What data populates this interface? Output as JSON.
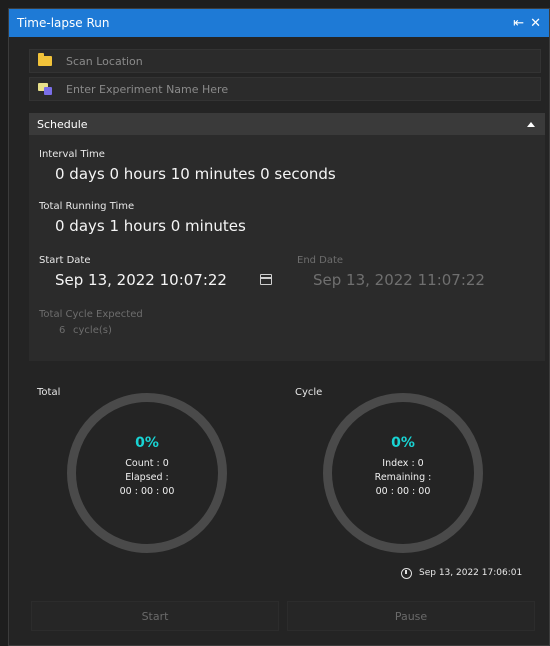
{
  "window": {
    "title": "Time-lapse Run",
    "pin_glyph": "⇤",
    "close_glyph": "✕"
  },
  "scan_location": {
    "placeholder": "Scan Location",
    "icon": "folder-icon"
  },
  "experiment_name": {
    "placeholder": "Enter Experiment Name Here",
    "icon": "tag-icon"
  },
  "schedule": {
    "header": "Schedule",
    "interval_label": "Interval Time",
    "interval_value": "0 days  0 hours  10 minutes  0 seconds",
    "total_running_label": "Total Running Time",
    "total_running_value": "0 days  1 hours  0 minutes",
    "start_date_label": "Start Date",
    "start_date_value": "Sep 13, 2022 10:07:22",
    "end_date_label": "End Date",
    "end_date_value": "Sep 13, 2022 11:07:22",
    "total_cycle_label": "Total Cycle Expected",
    "total_cycle_count": "6",
    "total_cycle_unit": "cycle(s)"
  },
  "progress": {
    "total": {
      "label": "Total",
      "percent": "0%",
      "count": "Count : 0",
      "elapsed_label": "Elapsed :",
      "elapsed_value": "00 : 00 : 00"
    },
    "cycle": {
      "label": "Cycle",
      "percent": "0%",
      "index": "Index : 0",
      "remaining_label": "Remaining :",
      "remaining_value": "00 : 00 : 00"
    },
    "timestamp": "Sep 13, 2022 17:06:01"
  },
  "buttons": {
    "start": "Start",
    "pause": "Pause"
  },
  "colors": {
    "title_bar": "#1e7ad6",
    "percent": "#19d3d3",
    "ring": "#4a4a4a"
  }
}
